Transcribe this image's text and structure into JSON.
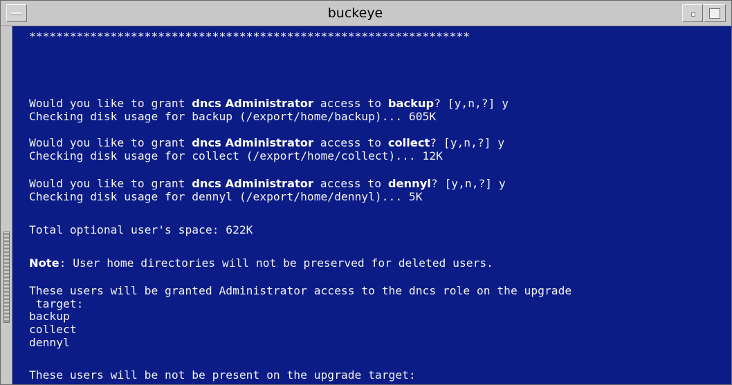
{
  "window": {
    "title": "buckeye"
  },
  "terminal": {
    "lines": [
      {
        "segments": [
          {
            "text": "*****************************************************************"
          }
        ]
      },
      {
        "segments": [
          {
            "text": "Would you like to grant "
          },
          {
            "text": "dncs Administrator",
            "bold": true
          },
          {
            "text": " access to "
          },
          {
            "text": "backup",
            "bold": true
          },
          {
            "text": "? [y,n,?] y"
          }
        ]
      },
      {
        "segments": [
          {
            "text": "Checking disk usage for backup (/export/home/backup)... 605K"
          }
        ]
      },
      {
        "segments": [
          {
            "text": "Would you like to grant "
          },
          {
            "text": "dncs Administrator",
            "bold": true
          },
          {
            "text": " access to "
          },
          {
            "text": "collect",
            "bold": true
          },
          {
            "text": "? [y,n,?] y"
          }
        ]
      },
      {
        "segments": [
          {
            "text": "Checking disk usage for collect (/export/home/collect)... 12K"
          }
        ]
      },
      {
        "segments": [
          {
            "text": "Would you like to grant "
          },
          {
            "text": "dncs Administrator",
            "bold": true
          },
          {
            "text": " access to "
          },
          {
            "text": "dennyl",
            "bold": true
          },
          {
            "text": "? [y,n,?] y"
          }
        ]
      },
      {
        "segments": [
          {
            "text": "Checking disk usage for dennyl (/export/home/dennyl)... 5K"
          }
        ]
      },
      {
        "segments": [
          {
            "text": "Total optional user's space: 622K"
          }
        ]
      },
      {
        "segments": [
          {
            "text": "Note",
            "bold": true
          },
          {
            "text": ": User home directories will not be preserved for deleted users."
          }
        ]
      },
      {
        "segments": [
          {
            "text": "These users will be granted Administrator access to the dncs role on the upgrade"
          }
        ]
      },
      {
        "segments": [
          {
            "text": " target:"
          }
        ]
      },
      {
        "segments": [
          {
            "text": "backup"
          }
        ]
      },
      {
        "segments": [
          {
            "text": "collect"
          }
        ]
      },
      {
        "segments": [
          {
            "text": "dennyl"
          }
        ]
      },
      {
        "segments": [
          {
            "text": "These users will be not be present on the upgrade target:"
          }
        ]
      }
    ]
  },
  "colors": {
    "terminal_bg": "#0b1c87",
    "terminal_fg": "#f2f2f2",
    "chrome": "#c8c8c8"
  },
  "icons": {
    "menu": "window-menu-icon",
    "minimize": "minimize-icon",
    "maximize": "maximize-icon"
  }
}
